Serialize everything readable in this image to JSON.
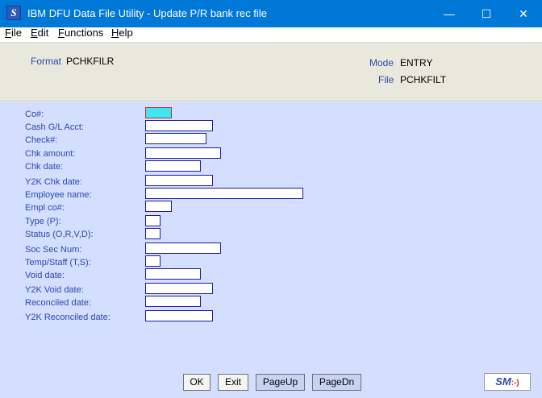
{
  "window": {
    "icon_letter": "S",
    "title": "IBM DFU Data File Utility - Update P/R bank rec file",
    "min_glyph": "—",
    "max_glyph": "☐",
    "close_glyph": "✕"
  },
  "menu": {
    "items": [
      {
        "first": "F",
        "rest": "ile"
      },
      {
        "first": "E",
        "rest": "dit"
      },
      {
        "first": "F",
        "rest": "unctions"
      },
      {
        "first": "H",
        "rest": "elp"
      }
    ]
  },
  "header": {
    "format_label": "Format",
    "format_value": "PCHKFILR",
    "mode_label": "Mode",
    "mode_value": "ENTRY",
    "file_label": "File",
    "file_value": "PCHKFILT"
  },
  "form": {
    "fields": [
      {
        "label": "Co#:",
        "value": ""
      },
      {
        "label": "Cash G/L Acct:",
        "value": ""
      },
      {
        "label": "Check#:",
        "value": ""
      },
      {
        "label": "Chk amount:",
        "value": ""
      },
      {
        "label": "Chk date:",
        "value": ""
      },
      {
        "label": "Y2K Chk date:",
        "value": ""
      },
      {
        "label": "Employee name:",
        "value": ""
      },
      {
        "label": "Empl co#:",
        "value": ""
      },
      {
        "label": "Type (P):",
        "value": ""
      },
      {
        "label": "Status (O,R,V,D):",
        "value": ""
      },
      {
        "label": "Soc Sec Num:",
        "value": ""
      },
      {
        "label": "Temp/Staff (T,S):",
        "value": ""
      },
      {
        "label": "Void date:",
        "value": ""
      },
      {
        "label": "Y2K Void date:",
        "value": ""
      },
      {
        "label": "Reconciled date:",
        "value": ""
      },
      {
        "label": "Y2K Reconciled date:",
        "value": ""
      }
    ]
  },
  "buttons": {
    "ok": "OK",
    "exit": "Exit",
    "pageup": "PageUp",
    "pagedn": "PageDn"
  },
  "logo": {
    "text": "SM",
    "smile": ":-)"
  },
  "colors": {
    "titlebar": "#0078d7",
    "form_bg": "#d4deff",
    "header_bg": "#e8e8dc",
    "label_blue": "#2b4aa8",
    "active_field": "#3fe8f0"
  }
}
